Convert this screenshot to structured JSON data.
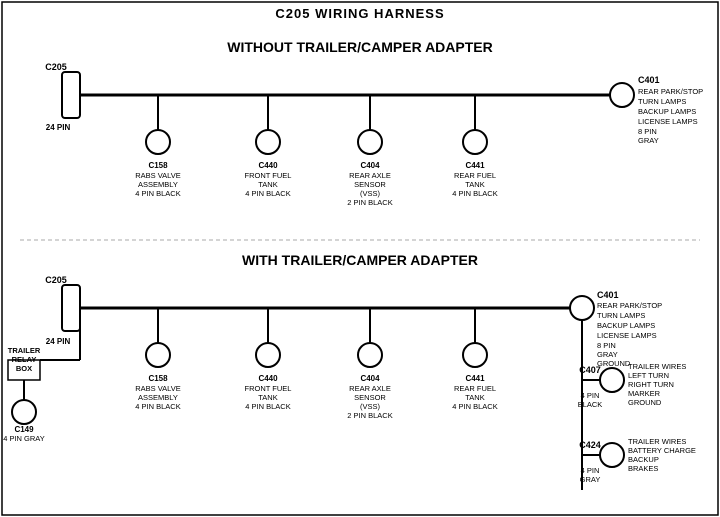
{
  "title": "C205 WIRING HARNESS",
  "section1": {
    "label": "WITHOUT TRAILER/CAMPER ADAPTER",
    "left_connector": {
      "name": "C205",
      "pins": "24 PIN"
    },
    "right_connector": {
      "name": "C401",
      "pins": "8 PIN",
      "color": "GRAY",
      "desc": "REAR PARK/STOP\nTURN LAMPS\nBACKUP LAMPS\nLICENSE LAMPS"
    },
    "connectors": [
      {
        "name": "C158",
        "desc": "RABS VALVE\nASSEMBLY\n4 PIN BLACK"
      },
      {
        "name": "C440",
        "desc": "FRONT FUEL\nTANK\n4 PIN BLACK"
      },
      {
        "name": "C404",
        "desc": "REAR AXLE\nSENSOR\n(VSS)\n2 PIN BLACK"
      },
      {
        "name": "C441",
        "desc": "REAR FUEL\nTANK\n4 PIN BLACK"
      }
    ]
  },
  "section2": {
    "label": "WITH TRAILER/CAMPER ADAPTER",
    "left_connector": {
      "name": "C205",
      "pins": "24 PIN"
    },
    "right_connector": {
      "name": "C401",
      "pins": "8 PIN",
      "color": "GRAY",
      "desc": "REAR PARK/STOP\nTURN LAMPS\nBACKUP LAMPS\nLICENSE LAMPS\nGROUND"
    },
    "trailer_relay": {
      "name": "TRAILER\nRELAY\nBOX"
    },
    "c149": {
      "name": "C149",
      "desc": "4 PIN GRAY"
    },
    "connectors": [
      {
        "name": "C158",
        "desc": "RABS VALVE\nASSEMBLY\n4 PIN BLACK"
      },
      {
        "name": "C440",
        "desc": "FRONT FUEL\nTANK\n4 PIN BLACK"
      },
      {
        "name": "C404",
        "desc": "REAR AXLE\nSENSOR\n(VSS)\n2 PIN BLACK"
      },
      {
        "name": "C441",
        "desc": "REAR FUEL\nTANK\n4 PIN BLACK"
      }
    ],
    "right_connectors": [
      {
        "name": "C407",
        "pins": "4 PIN",
        "color": "BLACK",
        "desc": "TRAILER WIRES\nLEFT TURN\nRIGHT TURN\nMARKER\nGROUND"
      },
      {
        "name": "C424",
        "pins": "4 PIN",
        "color": "GRAY",
        "desc": "TRAILER WIRES\nBATTERY CHARGE\nBACKUP\nBRAKES"
      }
    ]
  }
}
